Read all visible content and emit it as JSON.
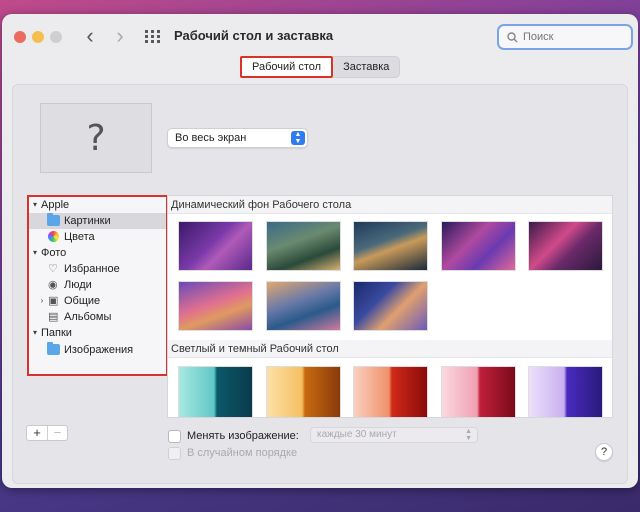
{
  "window": {
    "title": "Рабочий стол и заставка"
  },
  "search": {
    "placeholder": "Поиск"
  },
  "tabs": [
    {
      "label": "Рабочий стол",
      "active": true
    },
    {
      "label": "Заставка",
      "active": false
    }
  ],
  "preview": {
    "glyph": "?"
  },
  "fit_select": {
    "value": "Во весь экран"
  },
  "sidebar": {
    "groups": [
      {
        "label": "Apple",
        "items": [
          {
            "label": "Картинки",
            "icon": "folder-icon",
            "selected": true
          },
          {
            "label": "Цвета",
            "icon": "color-wheel-icon"
          }
        ]
      },
      {
        "label": "Фото",
        "items": [
          {
            "label": "Избранное",
            "icon": "heart-icon"
          },
          {
            "label": "Люди",
            "icon": "person-icon"
          },
          {
            "label": "Общие",
            "icon": "shared-icon"
          },
          {
            "label": "Альбомы",
            "icon": "album-icon"
          }
        ]
      },
      {
        "label": "Папки",
        "items": [
          {
            "label": "Изображения",
            "icon": "folder-icon"
          }
        ]
      }
    ]
  },
  "wallpapers": {
    "sections": [
      {
        "title": "Динамический фон Рабочего стола",
        "count": 8
      },
      {
        "title": "Светлый и темный Рабочий стол",
        "count": 5
      }
    ]
  },
  "controls": {
    "add_label": "+",
    "remove_label": "−",
    "change_picture_label": "Менять изображение:",
    "interval_value": "каждые 30 минут",
    "random_order_label": "В случайном порядке",
    "help_label": "?"
  }
}
